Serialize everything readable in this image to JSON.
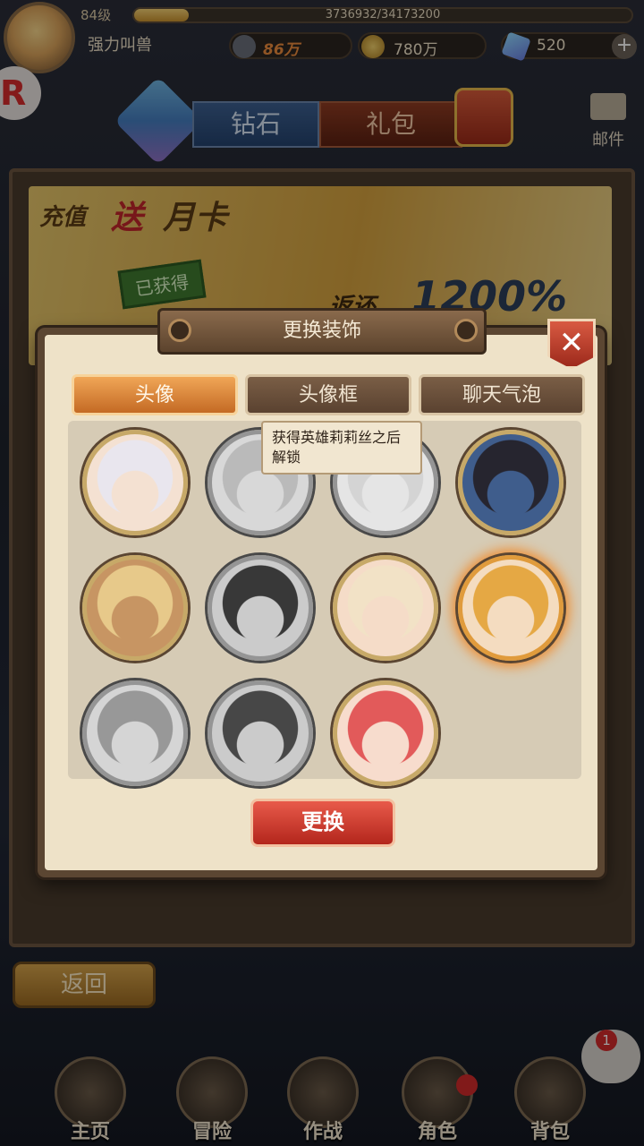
{
  "player": {
    "level": "84级",
    "name": "强力叫兽",
    "exp_text": "3736932/34173200",
    "exp_fraction": 0.109,
    "power": "86万",
    "gold": "780万",
    "diamonds": "520"
  },
  "icons": {
    "plus": "+",
    "close": "✕",
    "side_badge": "R"
  },
  "shop": {
    "tab_diamond": "钻石",
    "tab_gift": "礼包",
    "mail_label": "邮件",
    "banner_prefix": "充值",
    "banner_send": "送",
    "banner_card": "月卡",
    "banner_stamp": "已获得",
    "banner_return": "返还",
    "banner_percent": "1200%",
    "back": "返回"
  },
  "modal": {
    "title": "更换装饰",
    "tabs": [
      {
        "label": "头像",
        "active": true
      },
      {
        "label": "头像框",
        "active": false
      },
      {
        "label": "聊天气泡",
        "active": false
      }
    ],
    "tooltip": "获得英雄莉莉丝之后解锁",
    "confirm": "更换",
    "portraits": [
      {
        "hair": "#e9e6ee",
        "skin": "#f4e1d2",
        "locked": false,
        "selected": false
      },
      {
        "hair": "#bdbab5",
        "skin": "#dcd8d3",
        "locked": true,
        "selected": false
      },
      {
        "hair": "#d7d4d0",
        "skin": "#e8e5e2",
        "locked": true,
        "selected": false
      },
      {
        "hair": "#26252f",
        "skin": "#3f5d8c",
        "locked": false,
        "selected": false
      },
      {
        "hair": "#e7c98a",
        "skin": "#c79563",
        "locked": false,
        "selected": false
      },
      {
        "hair": "#3a3836",
        "skin": "#cfcbc6",
        "locked": true,
        "selected": false
      },
      {
        "hair": "#f2e2c6",
        "skin": "#f5dcc8",
        "locked": false,
        "selected": false
      },
      {
        "hair": "#e5a844",
        "skin": "#f4dcc0",
        "locked": false,
        "selected": true
      },
      {
        "hair": "#9c9893",
        "skin": "#d9d5d0",
        "locked": true,
        "selected": false
      },
      {
        "hair": "#4a4744",
        "skin": "#cfcac5",
        "locked": true,
        "selected": false
      },
      {
        "hair": "#e25a5a",
        "skin": "#f7dccd",
        "locked": false,
        "selected": false
      }
    ]
  },
  "nav": {
    "items": [
      "主页",
      "冒险",
      "作战",
      "角色",
      "背包"
    ],
    "chat_badge": "1"
  }
}
